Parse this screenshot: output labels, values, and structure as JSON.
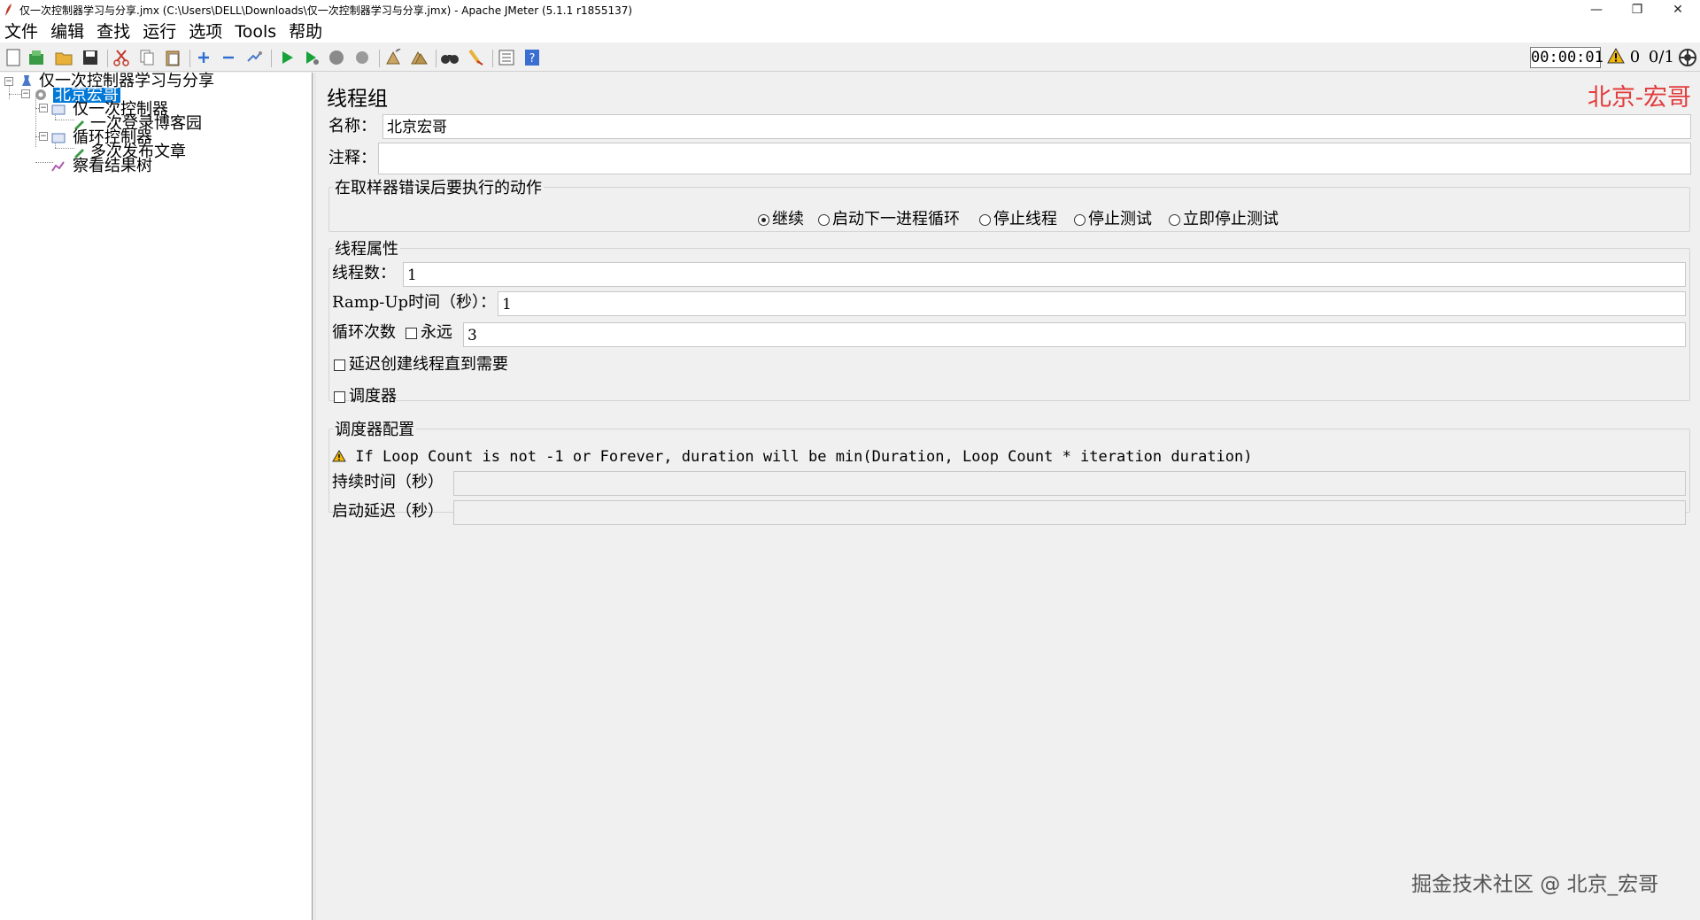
{
  "window": {
    "title": "仅一次控制器学习与分享.jmx (C:\\Users\\DELL\\Downloads\\仅一次控制器学习与分享.jmx) - Apache JMeter (5.1.1 r1855137)",
    "minimize": "—",
    "restore": "❐",
    "close": "✕"
  },
  "menu": [
    "文件",
    "编辑",
    "查找",
    "运行",
    "选项",
    "Tools",
    "帮助"
  ],
  "status": {
    "elapsed": "00:00:01",
    "errors": "0",
    "threads": "0/1"
  },
  "tree": {
    "root": "仅一次控制器学习与分享",
    "thread_group": "北京宏哥",
    "once_controller": "仅一次控制器",
    "login_sampler": "一次登录博客园",
    "loop_controller": "循环控制器",
    "publish_sampler": "多次发布文章",
    "listener": "察看结果树"
  },
  "panel": {
    "title": "线程组",
    "brand": "北京-宏哥",
    "name_label": "名称：",
    "name_value": "北京宏哥",
    "comment_label": "注释：",
    "comment_value": "",
    "error_action": {
      "legend": "在取样器错误后要执行的动作",
      "options": [
        "继续",
        "启动下一进程循环",
        "停止线程",
        "停止测试",
        "立即停止测试"
      ],
      "selected": "继续"
    },
    "thread_props": {
      "legend": "线程属性",
      "threads_label": "线程数：",
      "threads_value": "1",
      "rampup_label": "Ramp-Up时间（秒）：",
      "rampup_value": "1",
      "loop_label": "循环次数",
      "forever_label": "永远",
      "loop_value": "3",
      "delay_label": "延迟创建线程直到需要",
      "scheduler_label": "调度器"
    },
    "scheduler": {
      "legend": "调度器配置",
      "warning": "If Loop Count is not -1 or Forever, duration will be min(Duration, Loop Count * iteration duration)",
      "duration_label": "持续时间（秒）",
      "duration_value": "",
      "startup_label": "启动延迟（秒）",
      "startup_value": ""
    }
  },
  "watermark": "掘金技术社区 @ 北京_宏哥",
  "colors": {
    "brand": "#e23c3c",
    "selection": "#0078d7",
    "warning": "#f2b705"
  }
}
